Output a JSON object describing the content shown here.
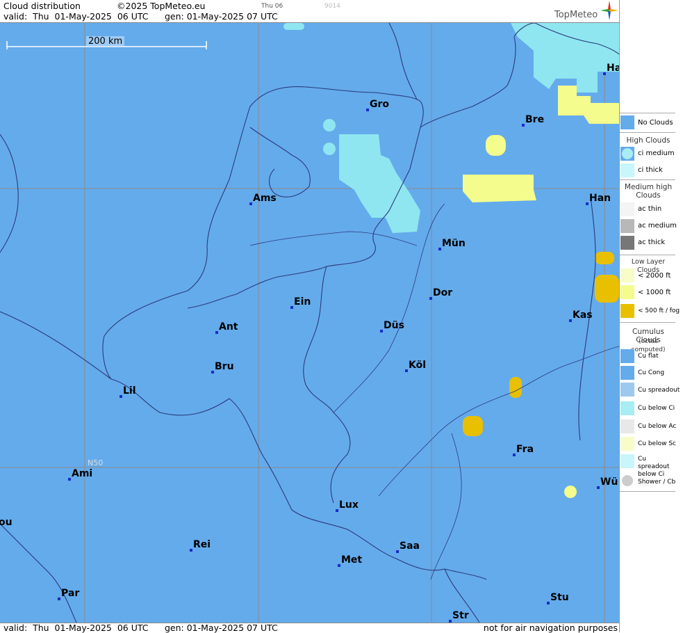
{
  "header": {
    "title": "Cloud distribution",
    "copyright": "©2025 TopMeteo.eu",
    "frame_label": "Thu 06",
    "code": "9014",
    "valid": "valid:  Thu  01-May-2025  06 UTC",
    "gen": "gen: 01-May-2025 07 UTC",
    "logo": "TopMeteo"
  },
  "map": {
    "scale_label": "200 km",
    "lat_label": "N50",
    "cities": [
      {
        "name": "Gro"
      },
      {
        "name": "Bre"
      },
      {
        "name": "Ha"
      },
      {
        "name": "Ams"
      },
      {
        "name": "Han"
      },
      {
        "name": "Mün"
      },
      {
        "name": "Dor"
      },
      {
        "name": "Ein"
      },
      {
        "name": "Ant"
      },
      {
        "name": "Düs"
      },
      {
        "name": "Kas"
      },
      {
        "name": "Bru"
      },
      {
        "name": "Köl"
      },
      {
        "name": "Lil"
      },
      {
        "name": "Fra"
      },
      {
        "name": "Ami"
      },
      {
        "name": "Wü"
      },
      {
        "name": "Lux"
      },
      {
        "name": "Rei"
      },
      {
        "name": "Saa"
      },
      {
        "name": "Met"
      },
      {
        "name": "Par"
      },
      {
        "name": "Stu"
      },
      {
        "name": "Str"
      },
      {
        "name": "ou"
      }
    ],
    "colors": {
      "sea_land": "#64abec",
      "ci_medium": "#8fe6f0",
      "low_2000": "#f3fc8c",
      "low_fog": "#e8c000",
      "lines": "#2a3a7a",
      "grid": "#8a8a8a"
    }
  },
  "footer": {
    "valid": "valid:  Thu  01-May-2025  06 UTC",
    "gen": "gen: 01-May-2025 07 UTC",
    "note": "not for air navigation purposes"
  },
  "legend": {
    "no_clouds": "No Clouds",
    "high_title": "High Clouds",
    "ci_medium": "ci medium",
    "ci_thick": "ci thick",
    "medium_title": "Medium high Clouds",
    "ac_thin": "ac thin",
    "ac_medium": "ac medium",
    "ac_thick": "ac thick",
    "low_title": "Low Layer Clouds",
    "low_2000": "< 2000 ft",
    "low_1000": "< 1000 ft",
    "low_500": "< 500 ft / fog",
    "cu_title": "Cumulus Clouds",
    "cu_sub": "(octas computed)",
    "cu_flat": "Cu flat",
    "cu_cong": "Cu Cong",
    "cu_spreadout": "Cu spreadout",
    "cu_below_ci": "Cu below Ci",
    "cu_below_ac": "Cu below Ac",
    "cu_below_sc": "Cu below Sc",
    "cu_spreadout_below_ci": "Cu spreadout below Ci",
    "shower": "Shower / Cb"
  }
}
